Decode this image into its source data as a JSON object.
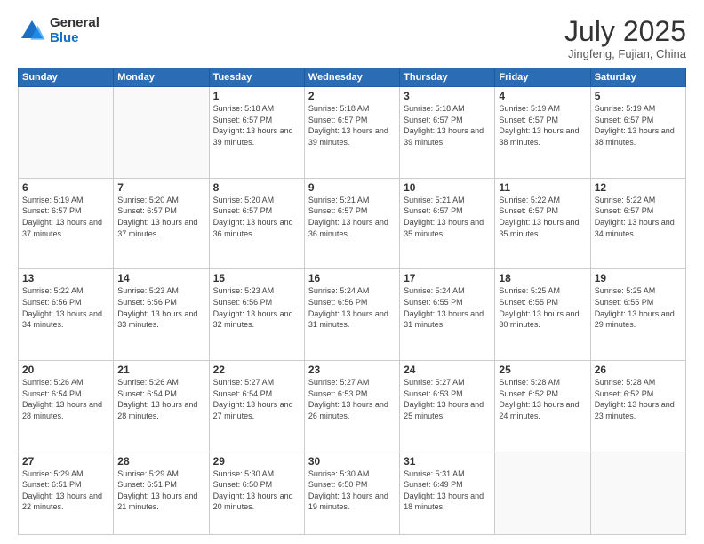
{
  "logo": {
    "general": "General",
    "blue": "Blue"
  },
  "title": "July 2025",
  "subtitle": "Jingfeng, Fujian, China",
  "days_of_week": [
    "Sunday",
    "Monday",
    "Tuesday",
    "Wednesday",
    "Thursday",
    "Friday",
    "Saturday"
  ],
  "weeks": [
    [
      {
        "day": "",
        "info": ""
      },
      {
        "day": "",
        "info": ""
      },
      {
        "day": "1",
        "info": "Sunrise: 5:18 AM\nSunset: 6:57 PM\nDaylight: 13 hours and 39 minutes."
      },
      {
        "day": "2",
        "info": "Sunrise: 5:18 AM\nSunset: 6:57 PM\nDaylight: 13 hours and 39 minutes."
      },
      {
        "day": "3",
        "info": "Sunrise: 5:18 AM\nSunset: 6:57 PM\nDaylight: 13 hours and 39 minutes."
      },
      {
        "day": "4",
        "info": "Sunrise: 5:19 AM\nSunset: 6:57 PM\nDaylight: 13 hours and 38 minutes."
      },
      {
        "day": "5",
        "info": "Sunrise: 5:19 AM\nSunset: 6:57 PM\nDaylight: 13 hours and 38 minutes."
      }
    ],
    [
      {
        "day": "6",
        "info": "Sunrise: 5:19 AM\nSunset: 6:57 PM\nDaylight: 13 hours and 37 minutes."
      },
      {
        "day": "7",
        "info": "Sunrise: 5:20 AM\nSunset: 6:57 PM\nDaylight: 13 hours and 37 minutes."
      },
      {
        "day": "8",
        "info": "Sunrise: 5:20 AM\nSunset: 6:57 PM\nDaylight: 13 hours and 36 minutes."
      },
      {
        "day": "9",
        "info": "Sunrise: 5:21 AM\nSunset: 6:57 PM\nDaylight: 13 hours and 36 minutes."
      },
      {
        "day": "10",
        "info": "Sunrise: 5:21 AM\nSunset: 6:57 PM\nDaylight: 13 hours and 35 minutes."
      },
      {
        "day": "11",
        "info": "Sunrise: 5:22 AM\nSunset: 6:57 PM\nDaylight: 13 hours and 35 minutes."
      },
      {
        "day": "12",
        "info": "Sunrise: 5:22 AM\nSunset: 6:57 PM\nDaylight: 13 hours and 34 minutes."
      }
    ],
    [
      {
        "day": "13",
        "info": "Sunrise: 5:22 AM\nSunset: 6:56 PM\nDaylight: 13 hours and 34 minutes."
      },
      {
        "day": "14",
        "info": "Sunrise: 5:23 AM\nSunset: 6:56 PM\nDaylight: 13 hours and 33 minutes."
      },
      {
        "day": "15",
        "info": "Sunrise: 5:23 AM\nSunset: 6:56 PM\nDaylight: 13 hours and 32 minutes."
      },
      {
        "day": "16",
        "info": "Sunrise: 5:24 AM\nSunset: 6:56 PM\nDaylight: 13 hours and 31 minutes."
      },
      {
        "day": "17",
        "info": "Sunrise: 5:24 AM\nSunset: 6:55 PM\nDaylight: 13 hours and 31 minutes."
      },
      {
        "day": "18",
        "info": "Sunrise: 5:25 AM\nSunset: 6:55 PM\nDaylight: 13 hours and 30 minutes."
      },
      {
        "day": "19",
        "info": "Sunrise: 5:25 AM\nSunset: 6:55 PM\nDaylight: 13 hours and 29 minutes."
      }
    ],
    [
      {
        "day": "20",
        "info": "Sunrise: 5:26 AM\nSunset: 6:54 PM\nDaylight: 13 hours and 28 minutes."
      },
      {
        "day": "21",
        "info": "Sunrise: 5:26 AM\nSunset: 6:54 PM\nDaylight: 13 hours and 28 minutes."
      },
      {
        "day": "22",
        "info": "Sunrise: 5:27 AM\nSunset: 6:54 PM\nDaylight: 13 hours and 27 minutes."
      },
      {
        "day": "23",
        "info": "Sunrise: 5:27 AM\nSunset: 6:53 PM\nDaylight: 13 hours and 26 minutes."
      },
      {
        "day": "24",
        "info": "Sunrise: 5:27 AM\nSunset: 6:53 PM\nDaylight: 13 hours and 25 minutes."
      },
      {
        "day": "25",
        "info": "Sunrise: 5:28 AM\nSunset: 6:52 PM\nDaylight: 13 hours and 24 minutes."
      },
      {
        "day": "26",
        "info": "Sunrise: 5:28 AM\nSunset: 6:52 PM\nDaylight: 13 hours and 23 minutes."
      }
    ],
    [
      {
        "day": "27",
        "info": "Sunrise: 5:29 AM\nSunset: 6:51 PM\nDaylight: 13 hours and 22 minutes."
      },
      {
        "day": "28",
        "info": "Sunrise: 5:29 AM\nSunset: 6:51 PM\nDaylight: 13 hours and 21 minutes."
      },
      {
        "day": "29",
        "info": "Sunrise: 5:30 AM\nSunset: 6:50 PM\nDaylight: 13 hours and 20 minutes."
      },
      {
        "day": "30",
        "info": "Sunrise: 5:30 AM\nSunset: 6:50 PM\nDaylight: 13 hours and 19 minutes."
      },
      {
        "day": "31",
        "info": "Sunrise: 5:31 AM\nSunset: 6:49 PM\nDaylight: 13 hours and 18 minutes."
      },
      {
        "day": "",
        "info": ""
      },
      {
        "day": "",
        "info": ""
      }
    ]
  ]
}
